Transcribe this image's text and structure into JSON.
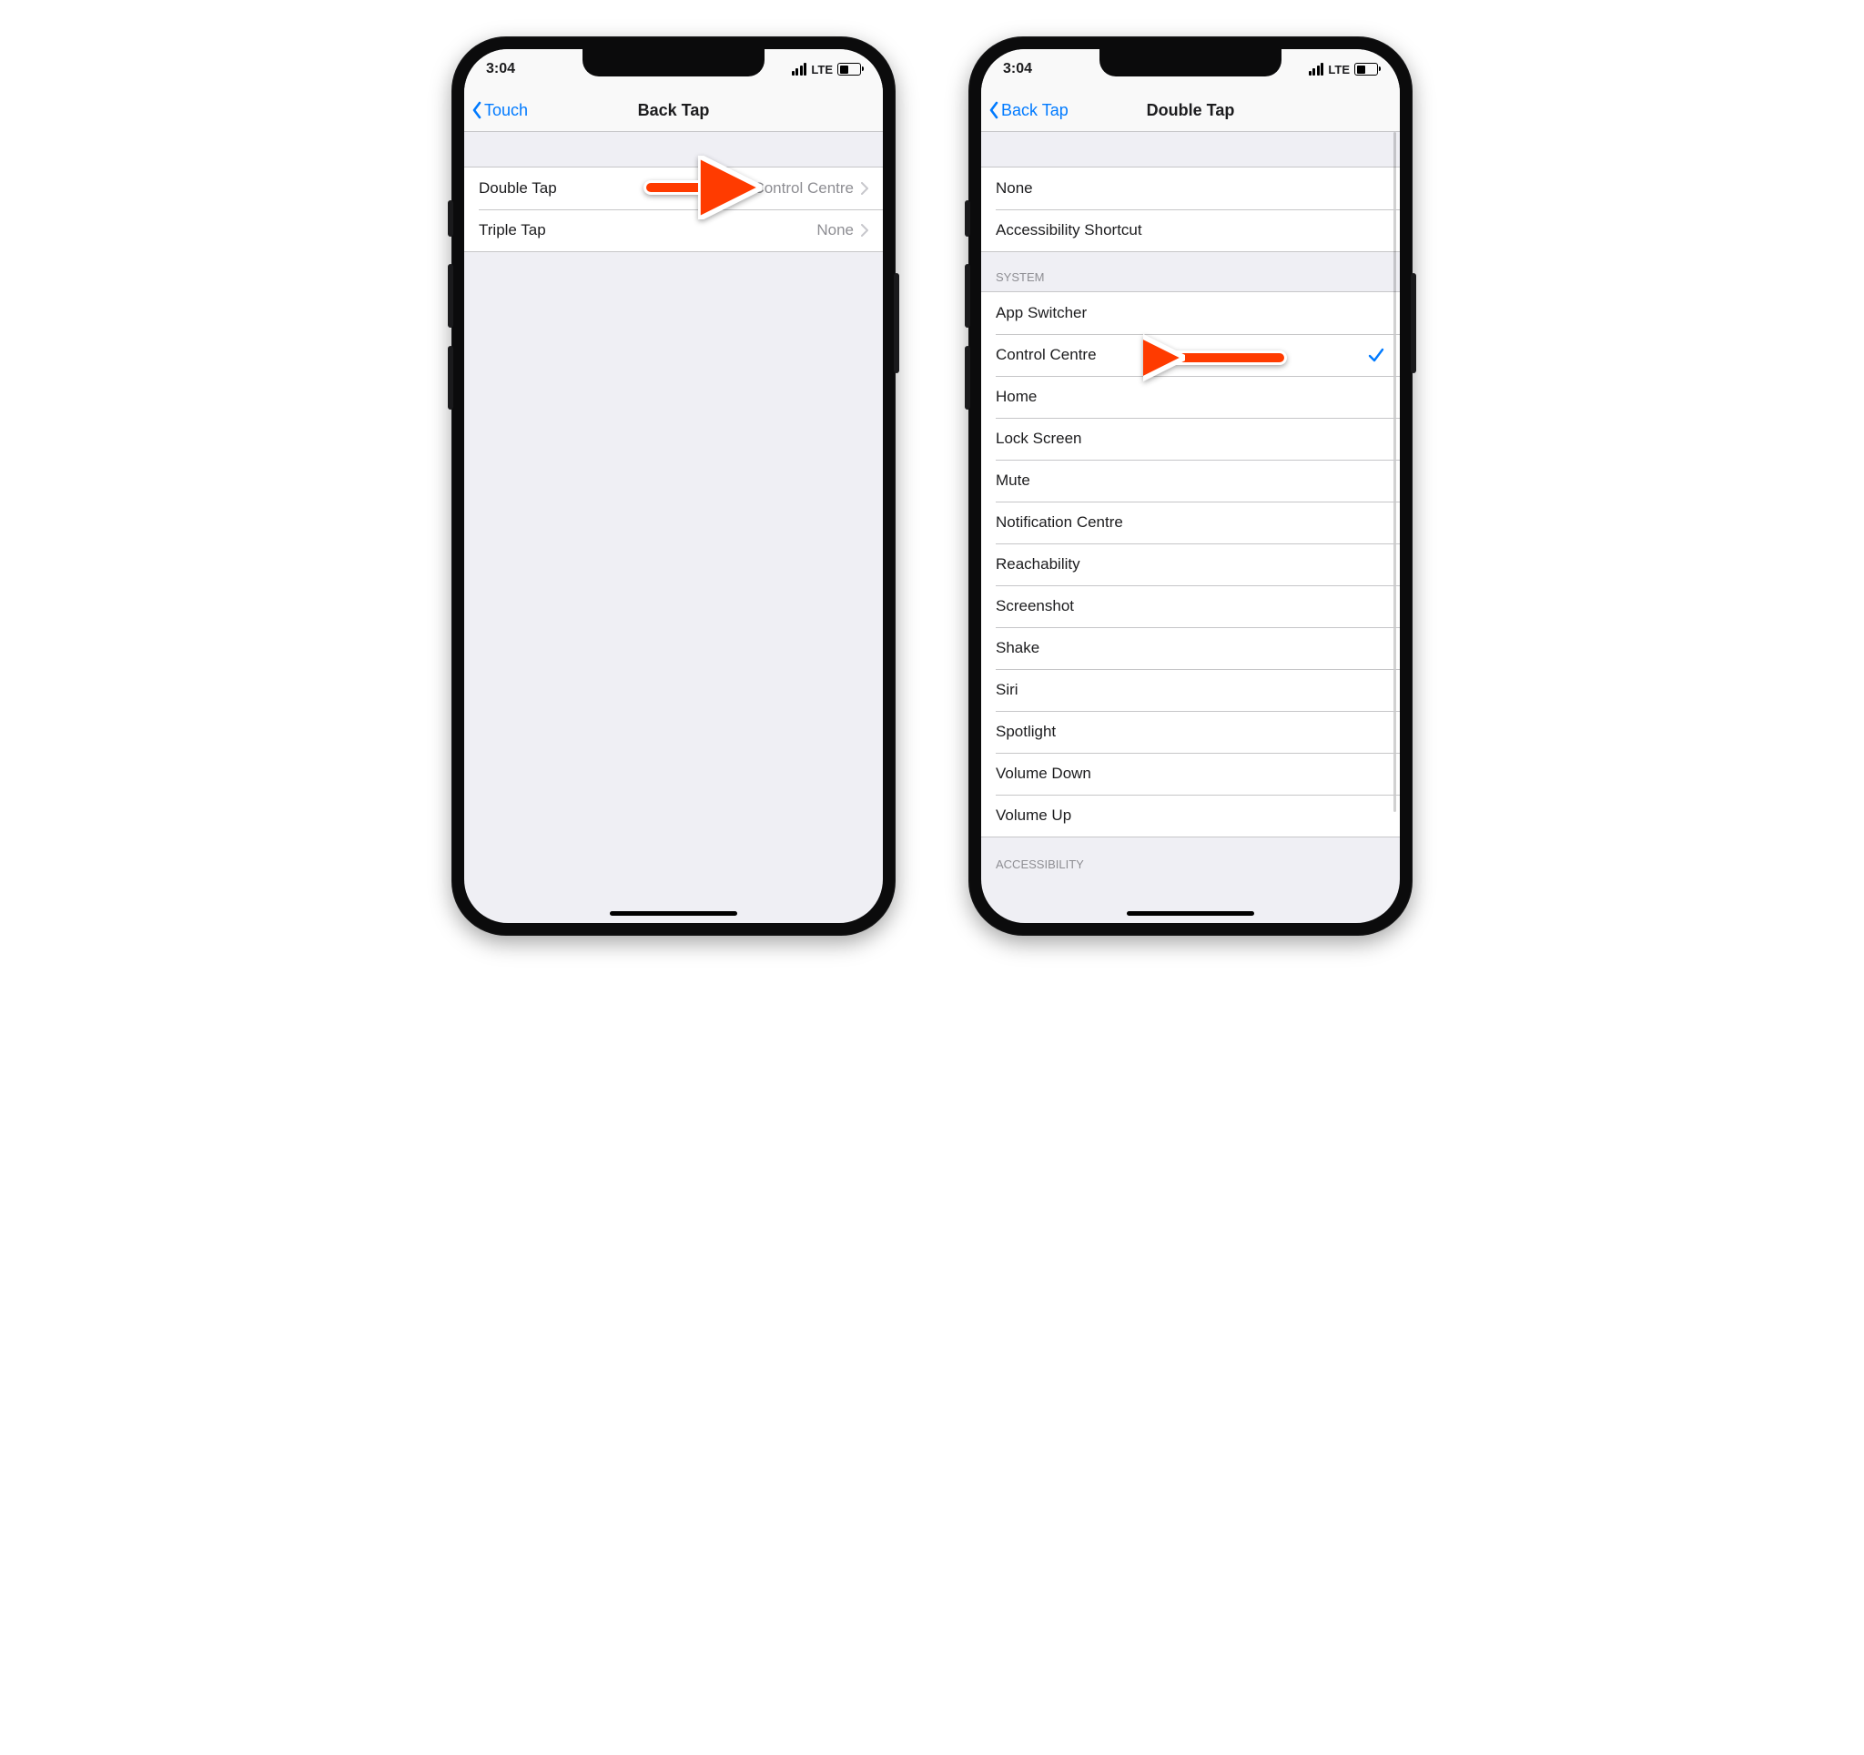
{
  "status": {
    "time": "3:04",
    "carrier": "LTE"
  },
  "left": {
    "back_label": "Touch",
    "title": "Back Tap",
    "rows": [
      {
        "label": "Double Tap",
        "value": "Control Centre"
      },
      {
        "label": "Triple Tap",
        "value": "None"
      }
    ]
  },
  "right": {
    "back_label": "Back Tap",
    "title": "Double Tap",
    "top_items": [
      "None",
      "Accessibility Shortcut"
    ],
    "system_header": "SYSTEM",
    "system_items": [
      "App Switcher",
      "Control Centre",
      "Home",
      "Lock Screen",
      "Mute",
      "Notification Centre",
      "Reachability",
      "Screenshot",
      "Shake",
      "Siri",
      "Spotlight",
      "Volume Down",
      "Volume Up"
    ],
    "selected_system_item": "Control Centre",
    "partial_header": "ACCESSIBILITY"
  },
  "colors": {
    "arrow": "#ff3b00",
    "blue": "#007aff"
  }
}
